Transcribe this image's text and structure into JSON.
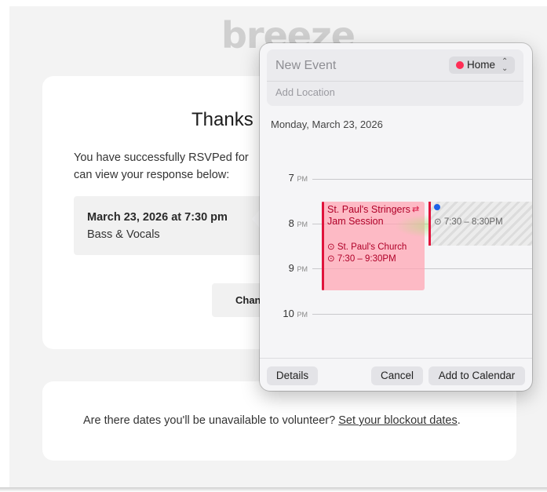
{
  "background": {
    "logo": "breeze",
    "heading": "Thanks",
    "rsvp_text": "You have successfully RSVPed for",
    "rsvp_text_2": "can view your response below:",
    "response": {
      "date": "March 23, 2026 at 7:30 pm",
      "role": "Bass & Vocals"
    },
    "change_button": "Chan",
    "blockout": {
      "prefix": "Are there dates you'll be unavailable to volunteer? ",
      "link": "Set your blockout dates",
      "suffix": "."
    }
  },
  "popover": {
    "title": "New Event",
    "calendar": {
      "label": "Home",
      "color": "#ff2d55"
    },
    "location_placeholder": "Add Location",
    "date": "Monday, March 23, 2026",
    "hours": [
      {
        "hour": "7",
        "ampm": "PM"
      },
      {
        "hour": "8",
        "ampm": "PM"
      },
      {
        "hour": "9",
        "ampm": "PM"
      },
      {
        "hour": "10",
        "ampm": "PM"
      }
    ],
    "existing_event": {
      "title": "St. Paul's Stringers Jam Session",
      "location": "St. Paul's Church",
      "time": "7:30 – 9:30PM",
      "color": "#e0143c"
    },
    "new_event": {
      "time": "7:30 – 8:30PM",
      "dot_color": "#1a62e8"
    },
    "buttons": {
      "details": "Details",
      "cancel": "Cancel",
      "add": "Add to Calendar"
    }
  }
}
